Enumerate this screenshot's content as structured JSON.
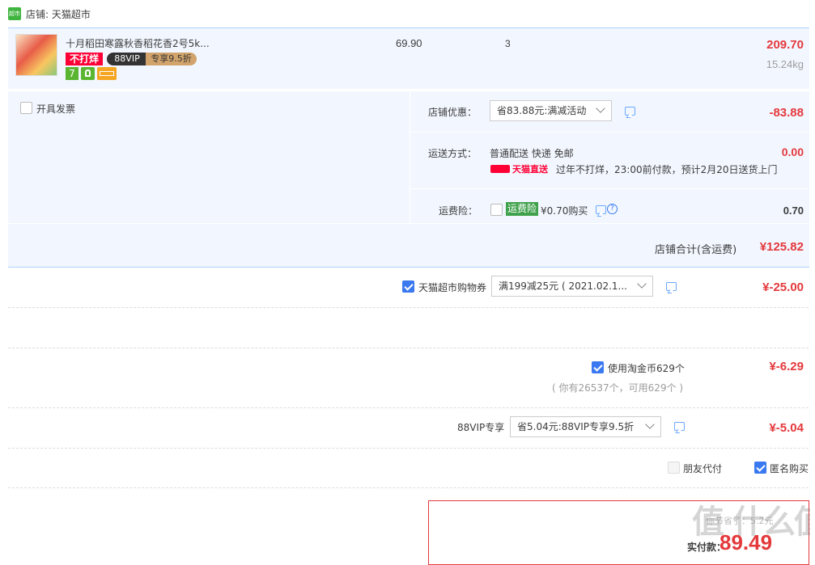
{
  "shop": {
    "badge": "超市",
    "label": "店铺: 天猫超市"
  },
  "item": {
    "title": "十月稻田寒露秋香稻花香2号5k...",
    "unit_price": "69.90",
    "quantity": "3",
    "subtotal": "209.70",
    "weight": "15.24kg",
    "tags": {
      "no_close": "不打烊",
      "vip": "88VIP",
      "vip_discount": "专享9.5折",
      "seven": "7"
    }
  },
  "invoice": {
    "label": "开具发票"
  },
  "shop_discount": {
    "label": "店铺优惠：",
    "value": "省83.88元:满减活动",
    "amount": "-83.88"
  },
  "delivery": {
    "label": "运送方式：",
    "method": "普通配送 快递 免邮",
    "amount": "0.00",
    "brand": "天猫直送",
    "note": "过年不打烊，23:00前付款，预计2月20日送货上门"
  },
  "freight_insurance": {
    "label": "运费险：",
    "badge": "运费险",
    "price": "¥0.70购买",
    "amount": "0.70"
  },
  "shop_total": {
    "label": "店铺合计(含运费)",
    "amount": "¥125.82"
  },
  "coupon": {
    "label": "天猫超市购物券",
    "value": "满199减25元 ( 2021.02.1...",
    "amount": "¥-25.00"
  },
  "coins": {
    "label": "使用淘金币629个",
    "note": "( 你有26537个，可用629个 )",
    "amount": "¥-6.29"
  },
  "vip": {
    "label": "88VIP专享",
    "value": "省5.04元:88VIP专享9.5折",
    "amount": "¥-5.04"
  },
  "options": {
    "friend_pay": "朋友代付",
    "anonymous": "匿名购买"
  },
  "pay_box": {
    "label": "实付款：",
    "amount": "89.49",
    "hint": "你节省了：5.2元"
  },
  "watermark": "值 什么值得买"
}
